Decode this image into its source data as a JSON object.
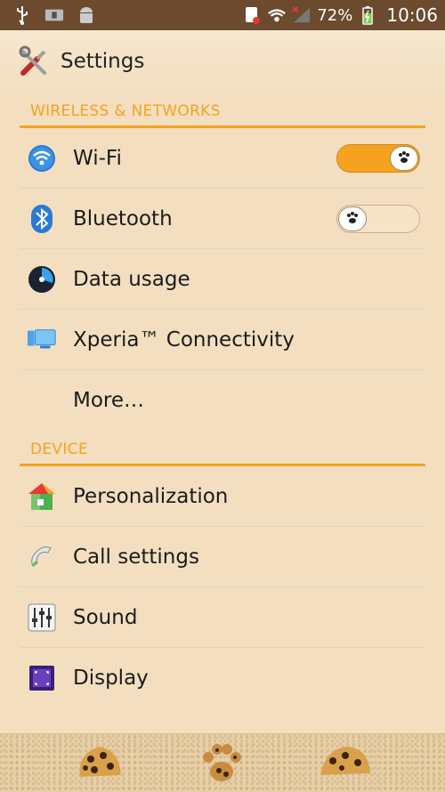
{
  "status_bar": {
    "battery_pct": "72%",
    "time": "10:06",
    "icons": [
      "usb-icon",
      "notification-icon",
      "android-icon",
      "sim-error-icon",
      "wifi-icon",
      "signal-icon",
      "battery-charging-icon"
    ]
  },
  "action_bar": {
    "title": "Settings",
    "icon": "settings-tools-icon"
  },
  "sections": [
    {
      "header": "WIRELESS & NETWORKS",
      "items": [
        {
          "label": "Wi-Fi",
          "icon": "wifi-icon",
          "toggle": true
        },
        {
          "label": "Bluetooth",
          "icon": "bluetooth-icon",
          "toggle": false
        },
        {
          "label": "Data usage",
          "icon": "data-usage-icon"
        },
        {
          "label": "Xperia™ Connectivity",
          "icon": "connectivity-icon"
        },
        {
          "label": "More…",
          "icon": ""
        }
      ]
    },
    {
      "header": "DEVICE",
      "items": [
        {
          "label": "Personalization",
          "icon": "personalization-icon"
        },
        {
          "label": "Call settings",
          "icon": "phone-icon"
        },
        {
          "label": "Sound",
          "icon": "sound-sliders-icon"
        },
        {
          "label": "Display",
          "icon": "display-icon"
        }
      ]
    }
  ],
  "colors": {
    "accent": "#f6a21e",
    "background": "#f3dfc0",
    "status_bar": "#6b4a2e"
  }
}
